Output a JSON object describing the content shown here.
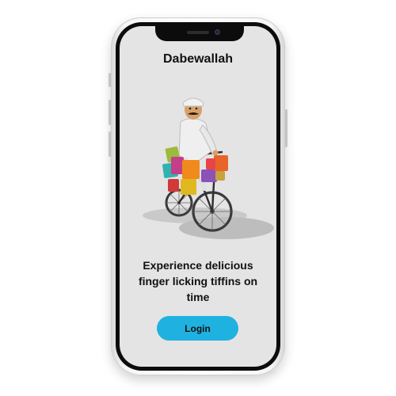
{
  "app": {
    "title": "Dabewallah"
  },
  "onboarding": {
    "tagline": "Experience delicious finger licking tiffins on time",
    "illustration_icon": "dabbawala-on-bicycle-illustration"
  },
  "actions": {
    "login_label": "Login"
  },
  "colors": {
    "accent": "#1fb2e0",
    "screen_bg": "#e4e4e4",
    "text": "#111111"
  }
}
